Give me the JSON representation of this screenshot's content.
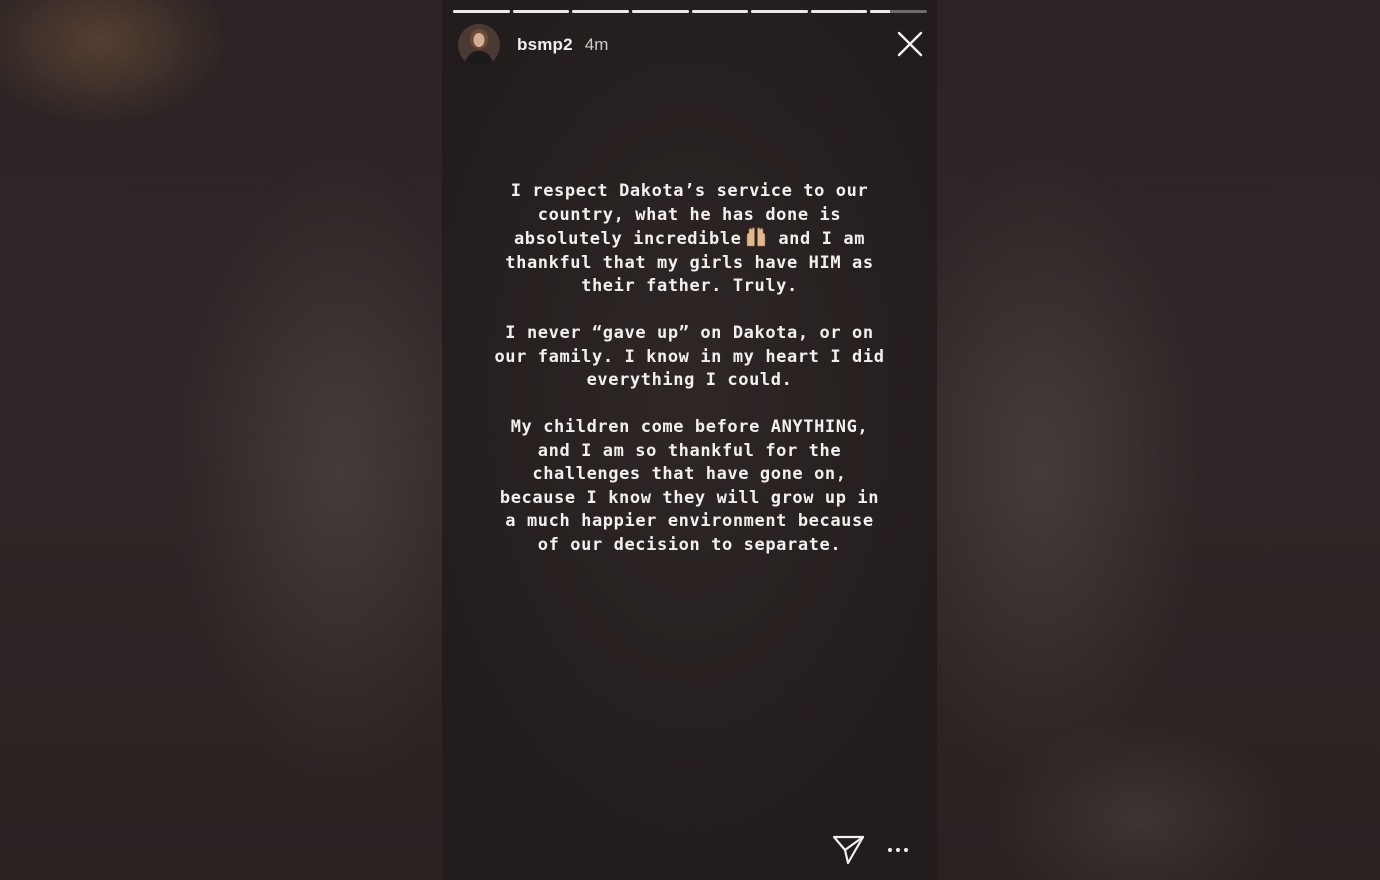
{
  "story": {
    "progress": {
      "segments": [
        1,
        1,
        1,
        1,
        1,
        1,
        1,
        0.35
      ]
    },
    "header": {
      "username": "bsmp2",
      "time": "4m",
      "avatar_icon": "profile-photo"
    },
    "close_icon": "close-icon",
    "text": {
      "paragraph1": "I respect Dakota’s service to our country, what he has done is absolutely incredible",
      "paragraph1_emoji": "raised-hands-emoji",
      "paragraph1_b": "and I am thankful that my girls have HIM as their father. Truly.",
      "paragraph2": "I never “gave up” on Dakota, or on our family. I know in my heart I did everything I could.",
      "paragraph3": "My children come before ANYTHING, and I am so thankful for the challenges that have gone on, because I know they will grow up in a much happier environment because of our decision to separate."
    },
    "footer": {
      "send_icon": "send-icon",
      "more_icon": "more-options-icon"
    }
  }
}
